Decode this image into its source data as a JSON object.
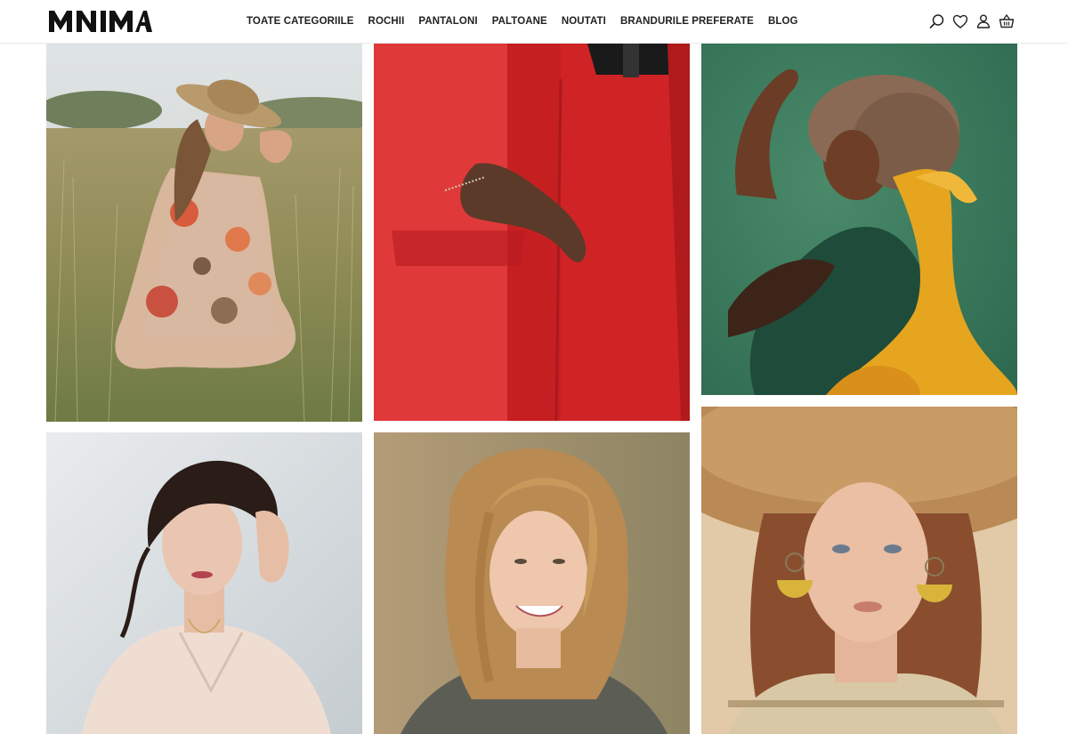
{
  "brand": {
    "logo_text": "MNIMA"
  },
  "nav": {
    "items": [
      {
        "label": "TOATE CATEGORIILE"
      },
      {
        "label": "ROCHII"
      },
      {
        "label": "PANTALONI"
      },
      {
        "label": "PALTOANE"
      },
      {
        "label": "NOUTATI"
      },
      {
        "label": "BRANDURILE PREFERATE"
      },
      {
        "label": "BLOG"
      }
    ]
  },
  "header_icons": [
    "search-icon",
    "heart-icon",
    "user-icon",
    "basket-icon"
  ],
  "gallery": {
    "tiles": [
      {
        "subject": "woman-in-floral-jumpsuit-and-straw-hat-in-field"
      },
      {
        "subject": "red-coat-and-red-trousers-closeup"
      },
      {
        "subject": "woman-with-yellow-scarf-on-green-backdrop"
      },
      {
        "subject": "woman-with-updo-in-blush-top"
      },
      {
        "subject": "smiling-blonde-woman-in-grey-top"
      },
      {
        "subject": "woman-in-straw-hat-with-yellow-earrings"
      }
    ]
  },
  "colors": {
    "text": "#222222",
    "border": "#ececec",
    "background": "#ffffff"
  }
}
